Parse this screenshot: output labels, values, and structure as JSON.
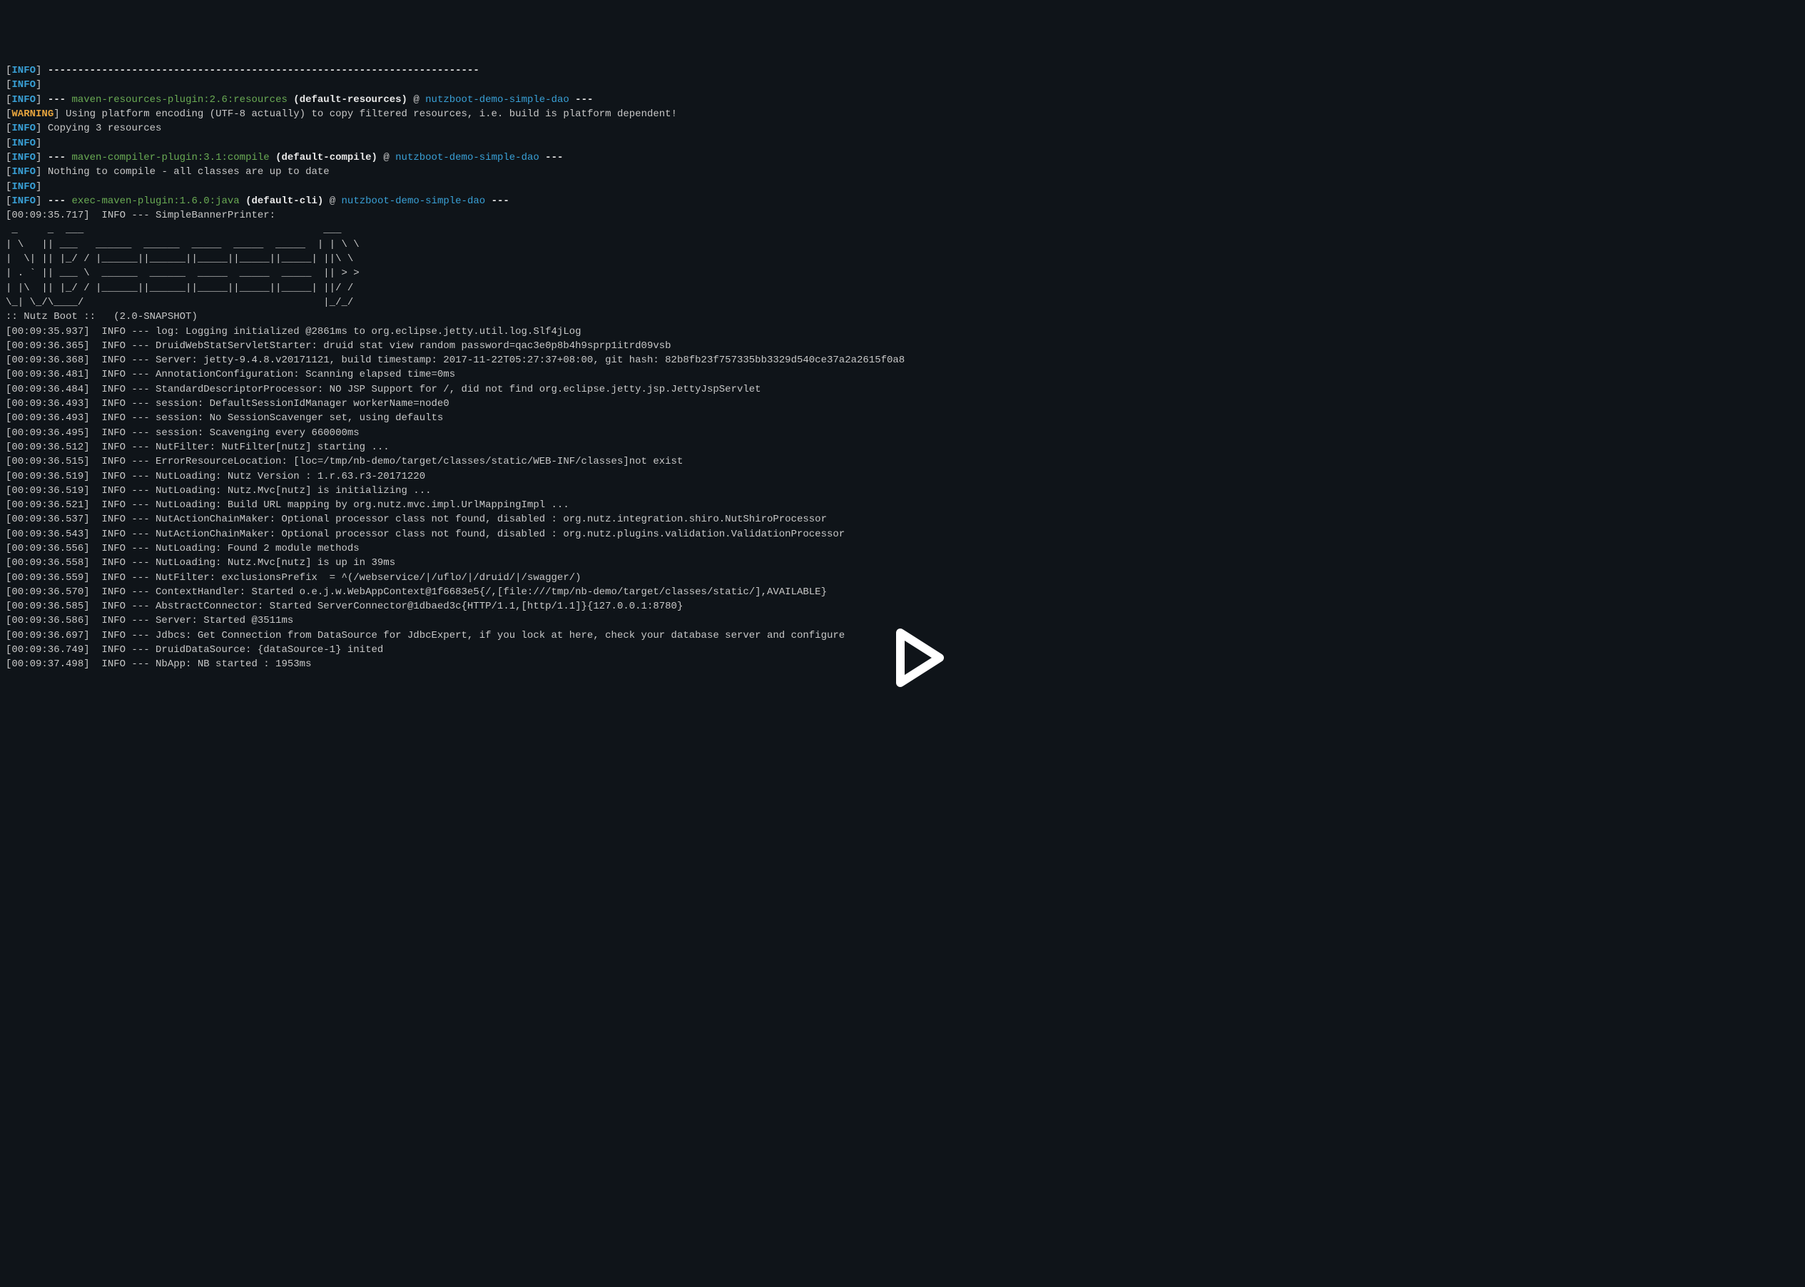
{
  "lines": [
    {
      "type": "info-dashes"
    },
    {
      "type": "info-empty"
    },
    {
      "type": "info-plugin",
      "plugin": "maven-resources-plugin:2.6:resources",
      "goal": "(default-resources)",
      "module": "nutzboot-demo-simple-dao"
    },
    {
      "type": "warning",
      "text": "Using platform encoding (UTF-8 actually) to copy filtered resources, i.e. build is platform dependent!"
    },
    {
      "type": "info-text",
      "text": "Copying 3 resources"
    },
    {
      "type": "info-empty"
    },
    {
      "type": "info-plugin",
      "plugin": "maven-compiler-plugin:3.1:compile",
      "goal": "(default-compile)",
      "module": "nutzboot-demo-simple-dao"
    },
    {
      "type": "info-text",
      "text": "Nothing to compile - all classes are up to date"
    },
    {
      "type": "info-empty"
    },
    {
      "type": "info-plugin",
      "plugin": "exec-maven-plugin:1.6.0:java",
      "goal": "(default-cli)",
      "module": "nutzboot-demo-simple-dao"
    },
    {
      "type": "app-log",
      "ts": "00:09:35.717",
      "text": "SimpleBannerPrinter:"
    },
    {
      "type": "raw",
      "text": " _     _  ___                                        ___"
    },
    {
      "type": "raw",
      "text": "| \\   || ___   ______  ______  _____  _____  _____  | | \\ \\"
    },
    {
      "type": "raw",
      "text": "|  \\| || |_/ / |______||______||_____||_____||_____| ||\\ \\"
    },
    {
      "type": "raw",
      "text": "| . ` || ___ \\  ______  ______  _____  _____  _____  || > >"
    },
    {
      "type": "raw",
      "text": "| |\\  || |_/ / |______||______||_____||_____||_____| ||/ /"
    },
    {
      "type": "raw",
      "text": "\\_| \\_/\\____/                                        |_/_/"
    },
    {
      "type": "raw",
      "text": ""
    },
    {
      "type": "raw",
      "text": ":: Nutz Boot ::   (2.0-SNAPSHOT)"
    },
    {
      "type": "app-log",
      "ts": "00:09:35.937",
      "text": "log: Logging initialized @2861ms to org.eclipse.jetty.util.log.Slf4jLog"
    },
    {
      "type": "app-log",
      "ts": "00:09:36.365",
      "text": "DruidWebStatServletStarter: druid stat view random password=qac3e0p8b4h9sprp1itrd09vsb"
    },
    {
      "type": "app-log",
      "ts": "00:09:36.368",
      "text": "Server: jetty-9.4.8.v20171121, build timestamp: 2017-11-22T05:27:37+08:00, git hash: 82b8fb23f757335bb3329d540ce37a2a2615f0a8"
    },
    {
      "type": "app-log",
      "ts": "00:09:36.481",
      "text": "AnnotationConfiguration: Scanning elapsed time=0ms"
    },
    {
      "type": "app-log",
      "ts": "00:09:36.484",
      "text": "StandardDescriptorProcessor: NO JSP Support for /, did not find org.eclipse.jetty.jsp.JettyJspServlet"
    },
    {
      "type": "app-log",
      "ts": "00:09:36.493",
      "text": "session: DefaultSessionIdManager workerName=node0"
    },
    {
      "type": "app-log",
      "ts": "00:09:36.493",
      "text": "session: No SessionScavenger set, using defaults"
    },
    {
      "type": "app-log",
      "ts": "00:09:36.495",
      "text": "session: Scavenging every 660000ms"
    },
    {
      "type": "app-log",
      "ts": "00:09:36.512",
      "text": "NutFilter: NutFilter[nutz] starting ..."
    },
    {
      "type": "app-log",
      "ts": "00:09:36.515",
      "text": "ErrorResourceLocation: [loc=/tmp/nb-demo/target/classes/static/WEB-INF/classes]not exist"
    },
    {
      "type": "app-log",
      "ts": "00:09:36.519",
      "text": "NutLoading: Nutz Version : 1.r.63.r3-20171220"
    },
    {
      "type": "app-log",
      "ts": "00:09:36.519",
      "text": "NutLoading: Nutz.Mvc[nutz] is initializing ..."
    },
    {
      "type": "app-log",
      "ts": "00:09:36.521",
      "text": "NutLoading: Build URL mapping by org.nutz.mvc.impl.UrlMappingImpl ..."
    },
    {
      "type": "app-log",
      "ts": "00:09:36.537",
      "text": "NutActionChainMaker: Optional processor class not found, disabled : org.nutz.integration.shiro.NutShiroProcessor"
    },
    {
      "type": "app-log",
      "ts": "00:09:36.543",
      "text": "NutActionChainMaker: Optional processor class not found, disabled : org.nutz.plugins.validation.ValidationProcessor"
    },
    {
      "type": "app-log",
      "ts": "00:09:36.556",
      "text": "NutLoading: Found 2 module methods"
    },
    {
      "type": "app-log",
      "ts": "00:09:36.558",
      "text": "NutLoading: Nutz.Mvc[nutz] is up in 39ms"
    },
    {
      "type": "app-log",
      "ts": "00:09:36.559",
      "text": "NutFilter: exclusionsPrefix  = ^(/webservice/|/uflo/|/druid/|/swagger/)"
    },
    {
      "type": "app-log",
      "ts": "00:09:36.570",
      "text": "ContextHandler: Started o.e.j.w.WebAppContext@1f6683e5{/,[file:///tmp/nb-demo/target/classes/static/],AVAILABLE}"
    },
    {
      "type": "app-log",
      "ts": "00:09:36.585",
      "text": "AbstractConnector: Started ServerConnector@1dbaed3c{HTTP/1.1,[http/1.1]}{127.0.0.1:8780}"
    },
    {
      "type": "app-log",
      "ts": "00:09:36.586",
      "text": "Server: Started @3511ms"
    },
    {
      "type": "app-log",
      "ts": "00:09:36.697",
      "text": "Jdbcs: Get Connection from DataSource for JdbcExpert, if you lock at here, check your database server and configure"
    },
    {
      "type": "app-log",
      "ts": "00:09:36.749",
      "text": "DruidDataSource: {dataSource-1} inited"
    },
    {
      "type": "app-log",
      "ts": "00:09:37.498",
      "text": "NbApp: NB started : 1953ms"
    }
  ],
  "labels": {
    "info": "INFO",
    "warning": "WARNING",
    "dashes_pre": "--- ",
    "dashes_post": " ---"
  }
}
